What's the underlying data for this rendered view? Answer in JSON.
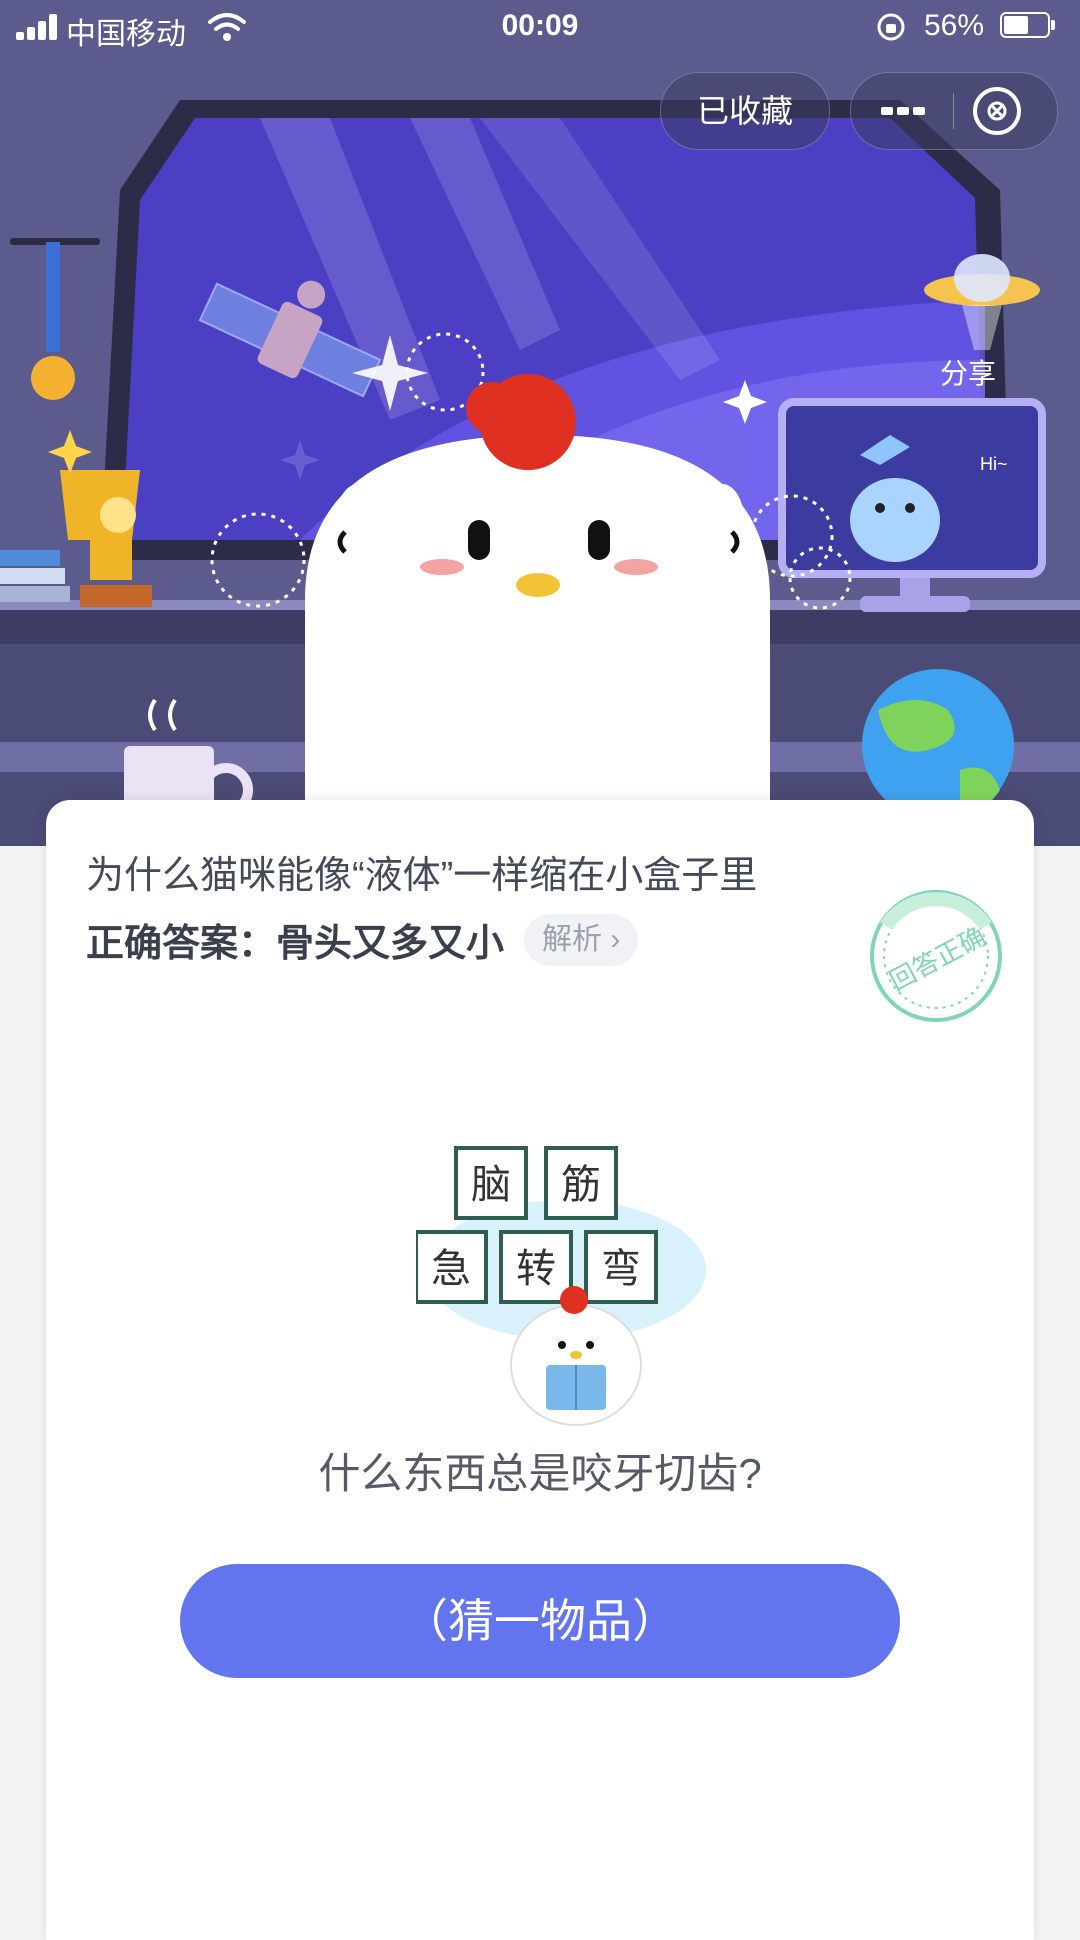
{
  "status_bar": {
    "carrier": "中国移动",
    "time": "00:09",
    "battery_percent": "56%",
    "battery_level": 0.56
  },
  "header": {
    "collected_label": "已收藏",
    "share_label": "分享"
  },
  "scene": {
    "monitor_text": "Hi~"
  },
  "card": {
    "question": "为什么猫咪能像“液体”一样缩在小盒子里",
    "answer_label": "正确答案：",
    "answer": "骨头又多又小",
    "explain_label": "解析",
    "stamp_text": "回答正确",
    "riddle_tiles": [
      "脑",
      "筋",
      "急",
      "转",
      "弯"
    ],
    "riddle_question": "什么东西总是咬牙切齿?",
    "guess_button": "（猜一物品）"
  },
  "colors": {
    "accent": "#6375ee",
    "scene_bg": "#5a5a8c",
    "stamp": "#7fd6b0"
  }
}
